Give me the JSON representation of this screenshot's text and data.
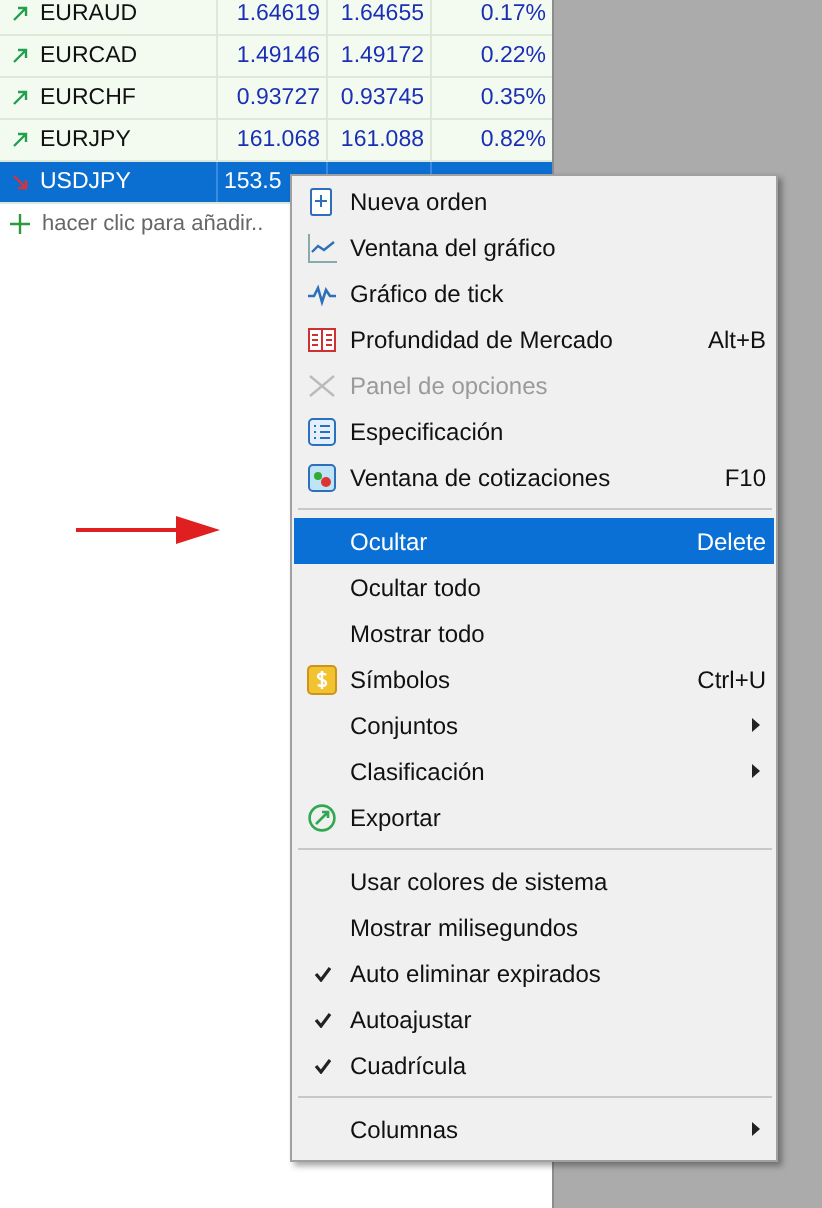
{
  "quotes": {
    "rows": [
      {
        "symbol": "EURAUD",
        "bid": "1.64619",
        "ask": "1.64655",
        "change": "0.17%",
        "rising": true,
        "selected": false
      },
      {
        "symbol": "EURCAD",
        "bid": "1.49146",
        "ask": "1.49172",
        "change": "0.22%",
        "rising": true,
        "selected": false
      },
      {
        "symbol": "EURCHF",
        "bid": "0.93727",
        "ask": "0.93745",
        "change": "0.35%",
        "rising": true,
        "selected": false
      },
      {
        "symbol": "EURJPY",
        "bid": "161.068",
        "ask": "161.088",
        "change": "0.82%",
        "rising": true,
        "selected": false
      },
      {
        "symbol": "USDJPY",
        "bid": "153.5",
        "rising": false,
        "selected": true
      }
    ],
    "add_row": {
      "symbol": "hacer clic para añadir.."
    }
  },
  "context_menu": {
    "items": [
      {
        "kind": "item",
        "label": "Nueva orden",
        "disabled": false,
        "selected": false
      },
      {
        "kind": "item",
        "label": "Ventana del gráfico",
        "disabled": false,
        "selected": false
      },
      {
        "kind": "item",
        "label": "Gráfico de tick",
        "disabled": false,
        "selected": false
      },
      {
        "kind": "item",
        "label": "Profundidad de Mercado",
        "shortcut": "Alt+B",
        "disabled": false,
        "selected": false
      },
      {
        "kind": "item",
        "label": "Panel de opciones",
        "disabled": true,
        "selected": false
      },
      {
        "kind": "item",
        "label": "Especificación",
        "disabled": false,
        "selected": false
      },
      {
        "kind": "item",
        "label": "Ventana de cotizaciones",
        "shortcut": "F10",
        "disabled": false,
        "selected": false
      },
      {
        "kind": "separator"
      },
      {
        "kind": "item",
        "label": "Ocultar",
        "shortcut": "Delete",
        "disabled": false,
        "selected": true
      },
      {
        "kind": "item",
        "label": "Ocultar todo",
        "disabled": false,
        "selected": false
      },
      {
        "kind": "item",
        "label": "Mostrar todo",
        "disabled": false,
        "selected": false
      },
      {
        "kind": "item",
        "label": "Símbolos",
        "shortcut": "Ctrl+U",
        "disabled": false,
        "selected": false
      },
      {
        "kind": "item",
        "label": "Conjuntos",
        "submenu": true,
        "disabled": false,
        "selected": false
      },
      {
        "kind": "item",
        "label": "Clasificación",
        "submenu": true,
        "disabled": false,
        "selected": false
      },
      {
        "kind": "item",
        "label": "Exportar",
        "disabled": false,
        "selected": false
      },
      {
        "kind": "separator"
      },
      {
        "kind": "item",
        "label": "Usar colores de sistema",
        "checked": false,
        "disabled": false,
        "selected": false
      },
      {
        "kind": "item",
        "label": "Mostrar milisegundos",
        "checked": false,
        "disabled": false,
        "selected": false
      },
      {
        "kind": "item",
        "label": "Auto eliminar expirados",
        "checked": true,
        "disabled": false,
        "selected": false
      },
      {
        "kind": "item",
        "label": "Autoajustar",
        "checked": true,
        "disabled": false,
        "selected": false
      },
      {
        "kind": "item",
        "label": "Cuadrícula",
        "checked": true,
        "disabled": false,
        "selected": false
      },
      {
        "kind": "separator"
      },
      {
        "kind": "item",
        "label": "Columnas",
        "submenu": true,
        "disabled": false,
        "selected": false
      }
    ]
  }
}
